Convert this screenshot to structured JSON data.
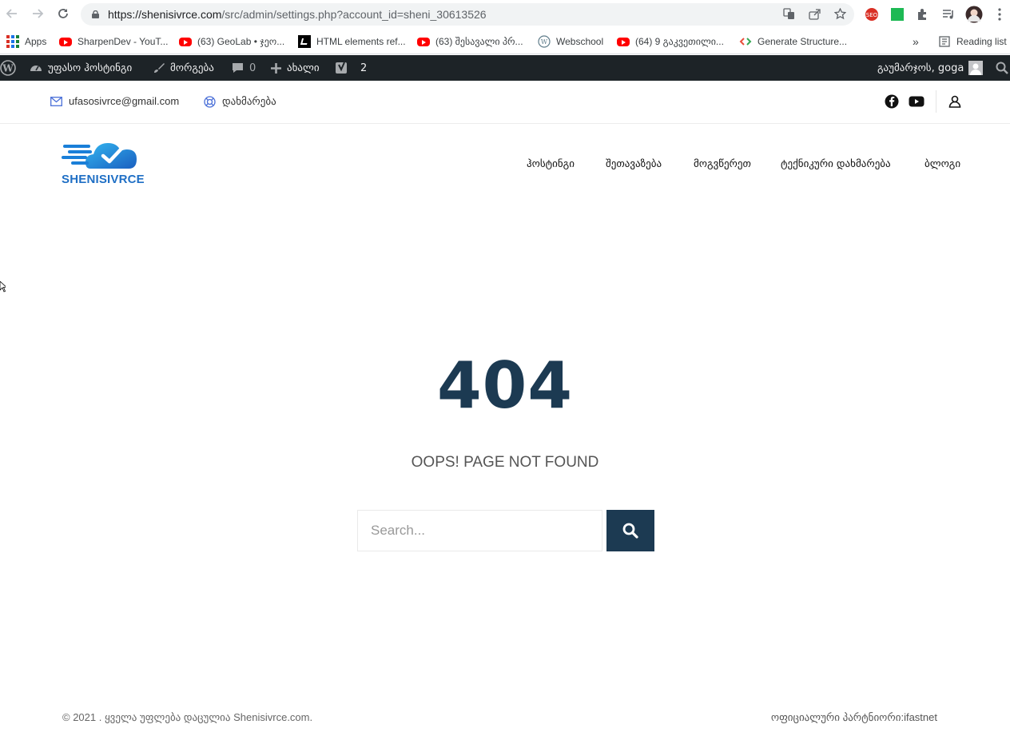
{
  "browser": {
    "url_main": "https://shenisivrce.com",
    "url_path": "/src/admin/settings.php?account_id=sheni_30613526",
    "back_icon": "arrow-left-icon",
    "forward_icon": "arrow-right-icon",
    "reload_icon": "reload-icon"
  },
  "bookmarks": {
    "items": [
      {
        "label": "Apps",
        "icon": "apps-grid-icon"
      },
      {
        "label": "SharpenDev - YouT...",
        "icon": "youtube-icon"
      },
      {
        "label": "(63) GeoLab • ჯეო...",
        "icon": "youtube-icon"
      },
      {
        "label": "HTML elements ref...",
        "icon": "mdn-icon"
      },
      {
        "label": "(63) შესავალი პრ...",
        "icon": "youtube-icon"
      },
      {
        "label": "Webschool",
        "icon": "wordpress-icon"
      },
      {
        "label": "(64) 9 გაკვეთილი...",
        "icon": "youtube-icon"
      },
      {
        "label": "Generate Structure...",
        "icon": "code-icon"
      }
    ],
    "more": "»",
    "reading_list": "Reading list"
  },
  "wp_admin_bar": {
    "site_name": "უფასო ჰოსტინგი",
    "customize": "მორგება",
    "comments_count": "0",
    "new": "ახალი",
    "yoast_count": "2",
    "greeting": "გაუმარჯოს, goga"
  },
  "top_strip": {
    "email": "ufasosivrce@gmail.com",
    "help": "დახმარება"
  },
  "header": {
    "logo_text": "SHENISIVRCE",
    "menu": [
      {
        "label": "ჰოსტინგი"
      },
      {
        "label": "შეთავაზება"
      },
      {
        "label": "მოგვწერეთ"
      },
      {
        "label": "ტექნიკური დახმარება"
      },
      {
        "label": "ბლოგი"
      }
    ]
  },
  "error": {
    "code": "404",
    "message": "OOPS! PAGE NOT FOUND",
    "search_placeholder": "Search..."
  },
  "footer": {
    "copyright": "© 2021 . ყველა უფლება დაცულია Shenisivrce.com.",
    "partner": "ოფიციალური პარტნიორი:ifastnet"
  },
  "colors": {
    "accent": "#1c3a52",
    "wp_bar": "#1d2327",
    "brand_blue": "#1f6fc5"
  }
}
